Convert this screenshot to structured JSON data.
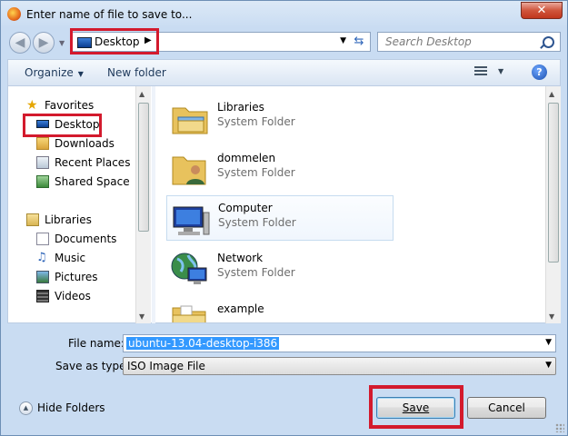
{
  "window": {
    "title": "Enter name of file to save to...",
    "close_label": "✕"
  },
  "address": {
    "location": "Desktop",
    "arrow": "▶"
  },
  "search": {
    "placeholder": "Search Desktop"
  },
  "toolbar": {
    "organize_label": "Organize",
    "new_folder_label": "New folder",
    "help_label": "?"
  },
  "nav": {
    "favorites": "Favorites",
    "favorites_items": [
      "Desktop",
      "Downloads",
      "Recent Places",
      "Shared Space"
    ],
    "libraries": "Libraries",
    "libraries_items": [
      "Documents",
      "Music",
      "Pictures",
      "Videos"
    ]
  },
  "files": [
    {
      "name": "Libraries",
      "type": "System Folder",
      "icon": "libraries-icon"
    },
    {
      "name": "dommelen",
      "type": "System Folder",
      "icon": "user-folder-icon"
    },
    {
      "name": "Computer",
      "type": "System Folder",
      "icon": "computer-icon"
    },
    {
      "name": "Network",
      "type": "System Folder",
      "icon": "network-icon"
    },
    {
      "name": "example",
      "type": "",
      "icon": "folder-icon"
    }
  ],
  "form": {
    "file_name_label": "File name:",
    "file_name_value": "ubuntu-13.04-desktop-i386",
    "save_as_type_label": "Save as type:",
    "save_as_type_value": "ISO Image File"
  },
  "footer": {
    "hide_folders_label": "Hide Folders",
    "save_label": "Save",
    "cancel_label": "Cancel"
  },
  "colors": {
    "highlight": "#d31a2d",
    "selection": "#3399ff"
  }
}
